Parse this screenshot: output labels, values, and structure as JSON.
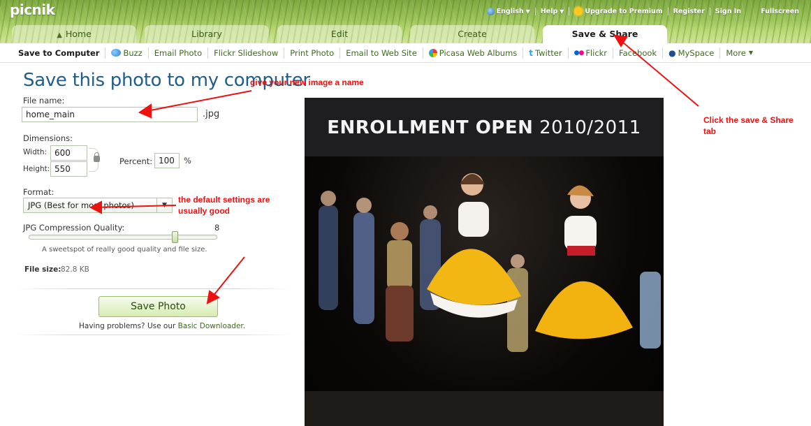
{
  "header": {
    "logo": "picnik",
    "topbar": {
      "language": "English",
      "help": "Help",
      "upgrade": "Upgrade to Premium",
      "register": "Register",
      "signin": "Sign In",
      "fullscreen": "Fullscreen"
    },
    "tabs": [
      {
        "label": "Home",
        "active": false
      },
      {
        "label": "Library",
        "active": false
      },
      {
        "label": "Edit",
        "active": false
      },
      {
        "label": "Create",
        "active": false
      },
      {
        "label": "Save & Share",
        "active": true
      }
    ]
  },
  "subnav": [
    {
      "label": "Save to Computer",
      "icon": "",
      "current": true
    },
    {
      "label": "Buzz",
      "icon": "buzz-icon"
    },
    {
      "label": "Email Photo",
      "icon": ""
    },
    {
      "label": "Flickr Slideshow",
      "icon": ""
    },
    {
      "label": "Print Photo",
      "icon": ""
    },
    {
      "label": "Email to Web Site",
      "icon": ""
    },
    {
      "label": "Picasa Web Albums",
      "icon": "picasa-icon"
    },
    {
      "label": "Twitter",
      "icon": "twitter-icon"
    },
    {
      "label": "Flickr",
      "icon": "flickr-icon"
    },
    {
      "label": "Facebook",
      "icon": ""
    },
    {
      "label": "MySpace",
      "icon": "myspace-icon"
    },
    {
      "label": "More",
      "icon": ""
    }
  ],
  "form": {
    "title": "Save this photo to my computer",
    "file_name_label": "File name:",
    "file_name_value": "home_main",
    "extension": ".jpg",
    "dimensions_label": "Dimensions:",
    "width_label": "Width:",
    "width_value": "600",
    "height_label": "Height:",
    "height_value": "550",
    "percent_label": "Percent:",
    "percent_value": "100",
    "percent_unit": "%",
    "format_label": "Format:",
    "format_value": "JPG (Best for most photos)",
    "quality_label": "JPG Compression Quality:",
    "quality_value": "8",
    "quality_hint": "A sweetspot of really good quality and file size.",
    "file_size_label": "File size:",
    "file_size_value": "82.8 KB",
    "save_button": "Save Photo",
    "problems_text": "Having problems? Use our",
    "basic_downloader": "Basic Downloader",
    "period": "."
  },
  "photo": {
    "banner_bold": "ENROLLMENT OPEN",
    "banner_year": "2010/2011"
  },
  "annotations": {
    "name_note": "give your new image a name",
    "defaults_note_1": "the default settings are",
    "defaults_note_2": "usually good",
    "tab_note_1": "Click the save & Share",
    "tab_note_2": "tab"
  },
  "colors": {
    "annotation": "#ee1111",
    "title_blue": "#1f5d8a",
    "link_green": "#3e6a1f"
  }
}
